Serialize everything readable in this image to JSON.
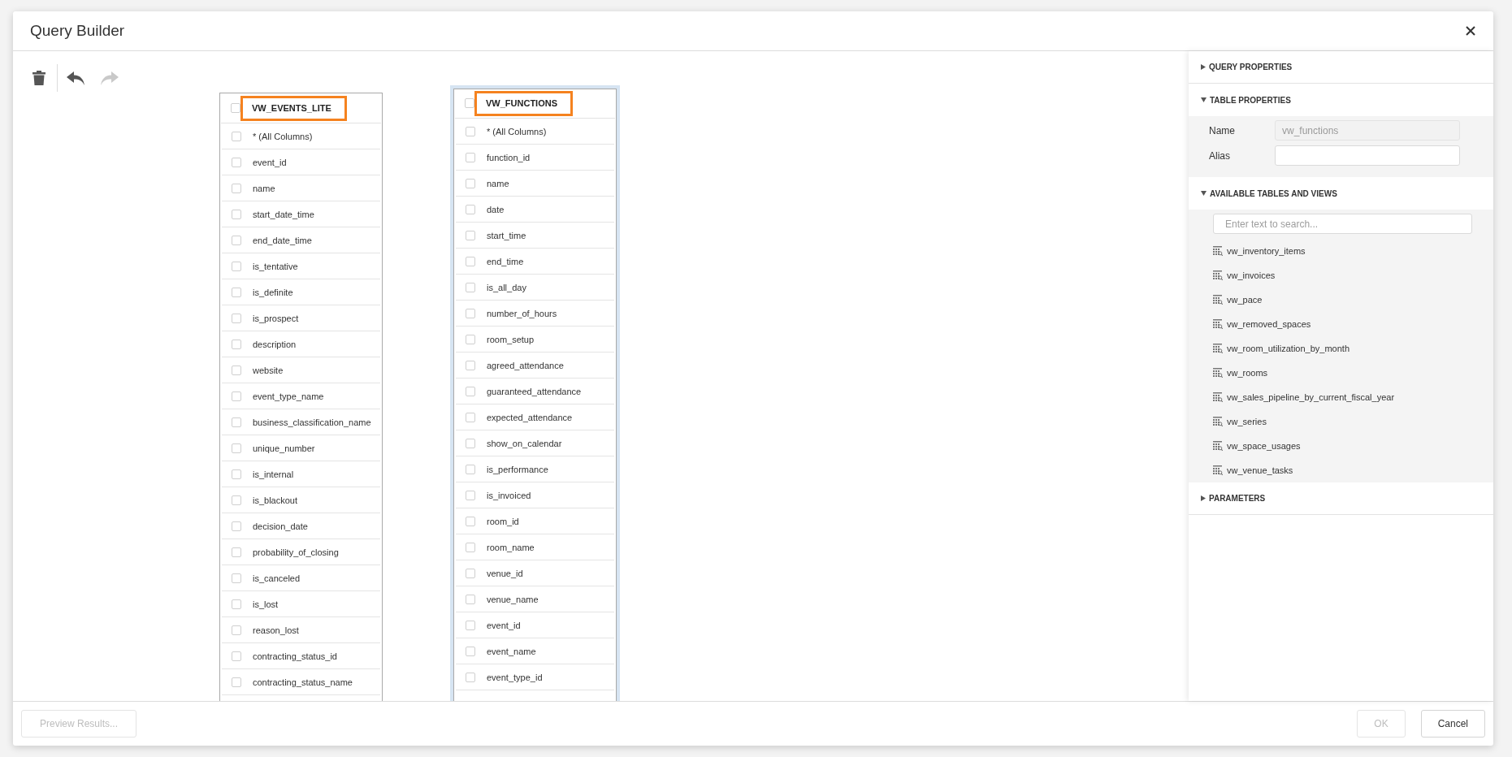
{
  "window": {
    "title": "Query Builder"
  },
  "toolbar": {
    "groups": [
      [
        {
          "kind": "delete",
          "disabled": false
        }
      ],
      [
        {
          "kind": "undo",
          "disabled": false
        },
        {
          "kind": "redo",
          "disabled": true
        }
      ]
    ]
  },
  "tables": [
    {
      "title": "VW_EVENTS_LITE",
      "selected": false,
      "checked": false,
      "columns": [
        {
          "name": "* (All Columns)",
          "checked": false
        },
        {
          "name": "event_id",
          "checked": false
        },
        {
          "name": "name",
          "checked": false
        },
        {
          "name": "start_date_time",
          "checked": false
        },
        {
          "name": "end_date_time",
          "checked": false
        },
        {
          "name": "is_tentative",
          "checked": false
        },
        {
          "name": "is_definite",
          "checked": false
        },
        {
          "name": "is_prospect",
          "checked": false
        },
        {
          "name": "description",
          "checked": false
        },
        {
          "name": "website",
          "checked": false
        },
        {
          "name": "event_type_name",
          "checked": false
        },
        {
          "name": "business_classification_name",
          "checked": false
        },
        {
          "name": "unique_number",
          "checked": false
        },
        {
          "name": "is_internal",
          "checked": false
        },
        {
          "name": "is_blackout",
          "checked": false
        },
        {
          "name": "decision_date",
          "checked": false
        },
        {
          "name": "probability_of_closing",
          "checked": false
        },
        {
          "name": "is_canceled",
          "checked": false
        },
        {
          "name": "is_lost",
          "checked": false
        },
        {
          "name": "reason_lost",
          "checked": false
        },
        {
          "name": "contracting_status_id",
          "checked": false
        },
        {
          "name": "contracting_status_name",
          "checked": false
        }
      ]
    },
    {
      "title": "VW_FUNCTIONS",
      "selected": true,
      "checked": false,
      "columns": [
        {
          "name": "* (All Columns)",
          "checked": false
        },
        {
          "name": "function_id",
          "checked": false
        },
        {
          "name": "name",
          "checked": false
        },
        {
          "name": "date",
          "checked": false
        },
        {
          "name": "start_time",
          "checked": false
        },
        {
          "name": "end_time",
          "checked": false
        },
        {
          "name": "is_all_day",
          "checked": false
        },
        {
          "name": "number_of_hours",
          "checked": false
        },
        {
          "name": "room_setup",
          "checked": false
        },
        {
          "name": "agreed_attendance",
          "checked": false
        },
        {
          "name": "guaranteed_attendance",
          "checked": false
        },
        {
          "name": "expected_attendance",
          "checked": false
        },
        {
          "name": "show_on_calendar",
          "checked": false
        },
        {
          "name": "is_performance",
          "checked": false
        },
        {
          "name": "is_invoiced",
          "checked": false
        },
        {
          "name": "room_id",
          "checked": false
        },
        {
          "name": "room_name",
          "checked": false
        },
        {
          "name": "venue_id",
          "checked": false
        },
        {
          "name": "venue_name",
          "checked": false
        },
        {
          "name": "event_id",
          "checked": false
        },
        {
          "name": "event_name",
          "checked": false
        },
        {
          "name": "event_type_id",
          "checked": false
        }
      ]
    }
  ],
  "properties_panel": {
    "sections": [
      {
        "title": "QUERY PROPERTIES",
        "expanded": false
      },
      {
        "kind": "fields",
        "title": "TABLE PROPERTIES",
        "expanded": true,
        "fields": [
          {
            "label": "Name",
            "value": "vw_functions",
            "disabled": true
          },
          {
            "label": "Alias",
            "disabled": false
          }
        ]
      },
      {
        "kind": "list",
        "title": "AVAILABLE TABLES AND VIEWS",
        "expanded": true,
        "search": {
          "placeholder": "Enter text to search..."
        },
        "items": [
          "vw_inventory_items",
          "vw_invoices",
          "vw_pace",
          "vw_removed_spaces",
          "vw_room_utilization_by_month",
          "vw_rooms",
          "vw_sales_pipeline_by_current_fiscal_year",
          "vw_series",
          "vw_space_usages",
          "vw_venue_tasks"
        ]
      },
      {
        "title": "PARAMETERS",
        "expanded": false
      }
    ]
  },
  "footer": {
    "left_buttons": [
      {
        "label": "Preview Results...",
        "disabled": true
      }
    ],
    "right_buttons": [
      {
        "label": "OK",
        "disabled": true
      },
      {
        "label": "Cancel",
        "disabled": false
      }
    ]
  }
}
